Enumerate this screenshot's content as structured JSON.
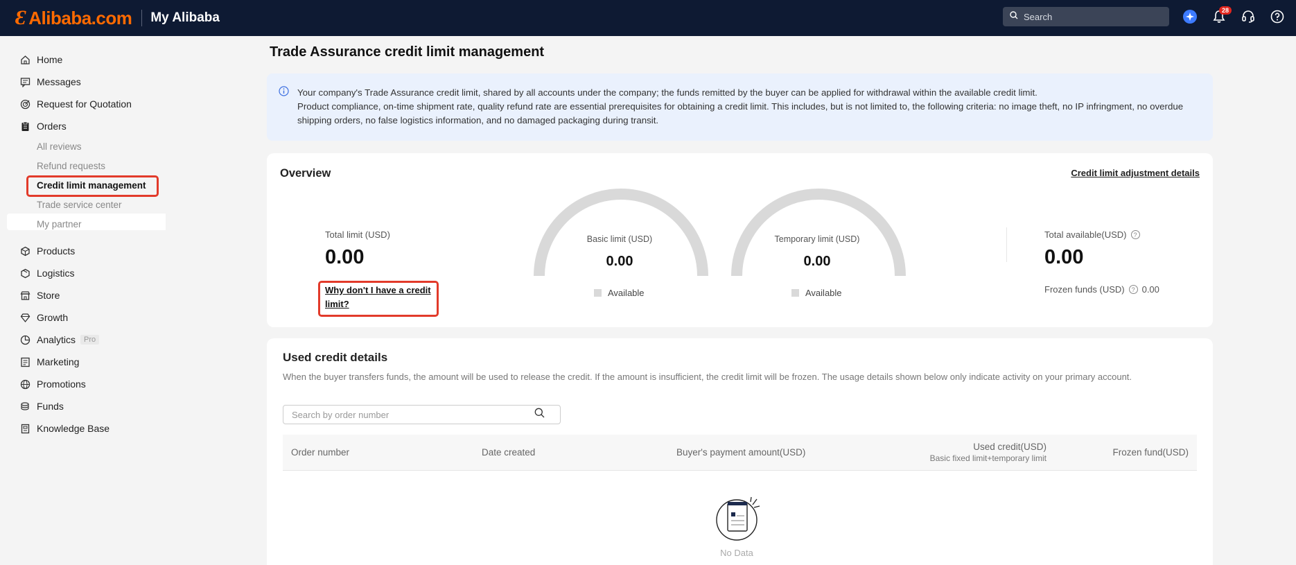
{
  "topbar": {
    "logo_mark": "Ɛ",
    "logo_text": "Alibaba.com",
    "section_title": "My Alibaba",
    "search_placeholder": "Search",
    "notification_count": "28"
  },
  "sidebar": {
    "items": [
      {
        "label": "Home",
        "icon": "home-icon"
      },
      {
        "label": "Messages",
        "icon": "message-icon"
      },
      {
        "label": "Request for Quotation",
        "icon": "target-icon"
      },
      {
        "label": "Orders",
        "icon": "clipboard-icon"
      },
      {
        "label": "Products",
        "icon": "box-icon"
      },
      {
        "label": "Logistics",
        "icon": "truck-icon"
      },
      {
        "label": "Store",
        "icon": "store-icon"
      },
      {
        "label": "Growth",
        "icon": "diamond-icon"
      },
      {
        "label": "Analytics",
        "icon": "pie-chart-icon",
        "tag": "Pro"
      },
      {
        "label": "Marketing",
        "icon": "marketing-icon"
      },
      {
        "label": "Promotions",
        "icon": "globe-icon"
      },
      {
        "label": "Funds",
        "icon": "coins-icon"
      },
      {
        "label": "Knowledge Base",
        "icon": "book-icon"
      }
    ],
    "order_subitems": [
      "All reviews",
      "Refund requests",
      "Credit limit management",
      "Trade service center",
      "My partner"
    ],
    "active_subitem": "Credit limit management"
  },
  "main": {
    "title": "Trade Assurance credit limit management",
    "info_line1": "Your company's Trade Assurance credit limit, shared by all accounts under the company; the funds remitted by the buyer can be applied for withdrawal within the available credit limit.",
    "info_line2": "Product compliance, on-time shipment rate, quality refund rate are essential prerequisites for obtaining a credit limit. This includes, but is not limited to, the following criteria: no image theft, no IP infringment, no overdue shipping orders, no false logistics information, and no damaged packaging during transit.",
    "overview": {
      "title": "Overview",
      "adjustment_link": "Credit limit adjustment details",
      "total_limit_label": "Total limit (USD)",
      "total_limit_value": "0.00",
      "why_link": "Why don't I have a credit limit?",
      "basic_limit_label": "Basic limit (USD)",
      "basic_limit_value": "0.00",
      "basic_legend": "Available",
      "temp_limit_label": "Temporary limit (USD)",
      "temp_limit_value": "0.00",
      "temp_legend": "Available",
      "total_available_label": "Total available(USD)",
      "total_available_value": "0.00",
      "frozen_label": "Frozen funds (USD)",
      "frozen_value": "0.00"
    },
    "used_credit": {
      "title": "Used credit details",
      "description": "When the buyer transfers funds, the amount will be used to release the credit. If the amount is insufficient, the credit limit will be frozen. The usage details shown below only indicate activity on your primary account.",
      "search_placeholder": "Search by order number",
      "columns": {
        "order_number": "Order number",
        "date_created": "Date created",
        "buyer_payment": "Buyer's payment amount(USD)",
        "used_credit": "Used credit(USD)",
        "used_credit_sub": "Basic fixed limit+temporary limit",
        "frozen_fund": "Frozen fund(USD)"
      },
      "empty_text": "No Data"
    }
  },
  "colors": {
    "topbar_bg": "#0e1a33",
    "brand_orange": "#ff6a00",
    "highlight_red": "#e23a2a",
    "gauge_gray": "#d9d9d9",
    "info_banner_bg": "#eaf1fd"
  }
}
